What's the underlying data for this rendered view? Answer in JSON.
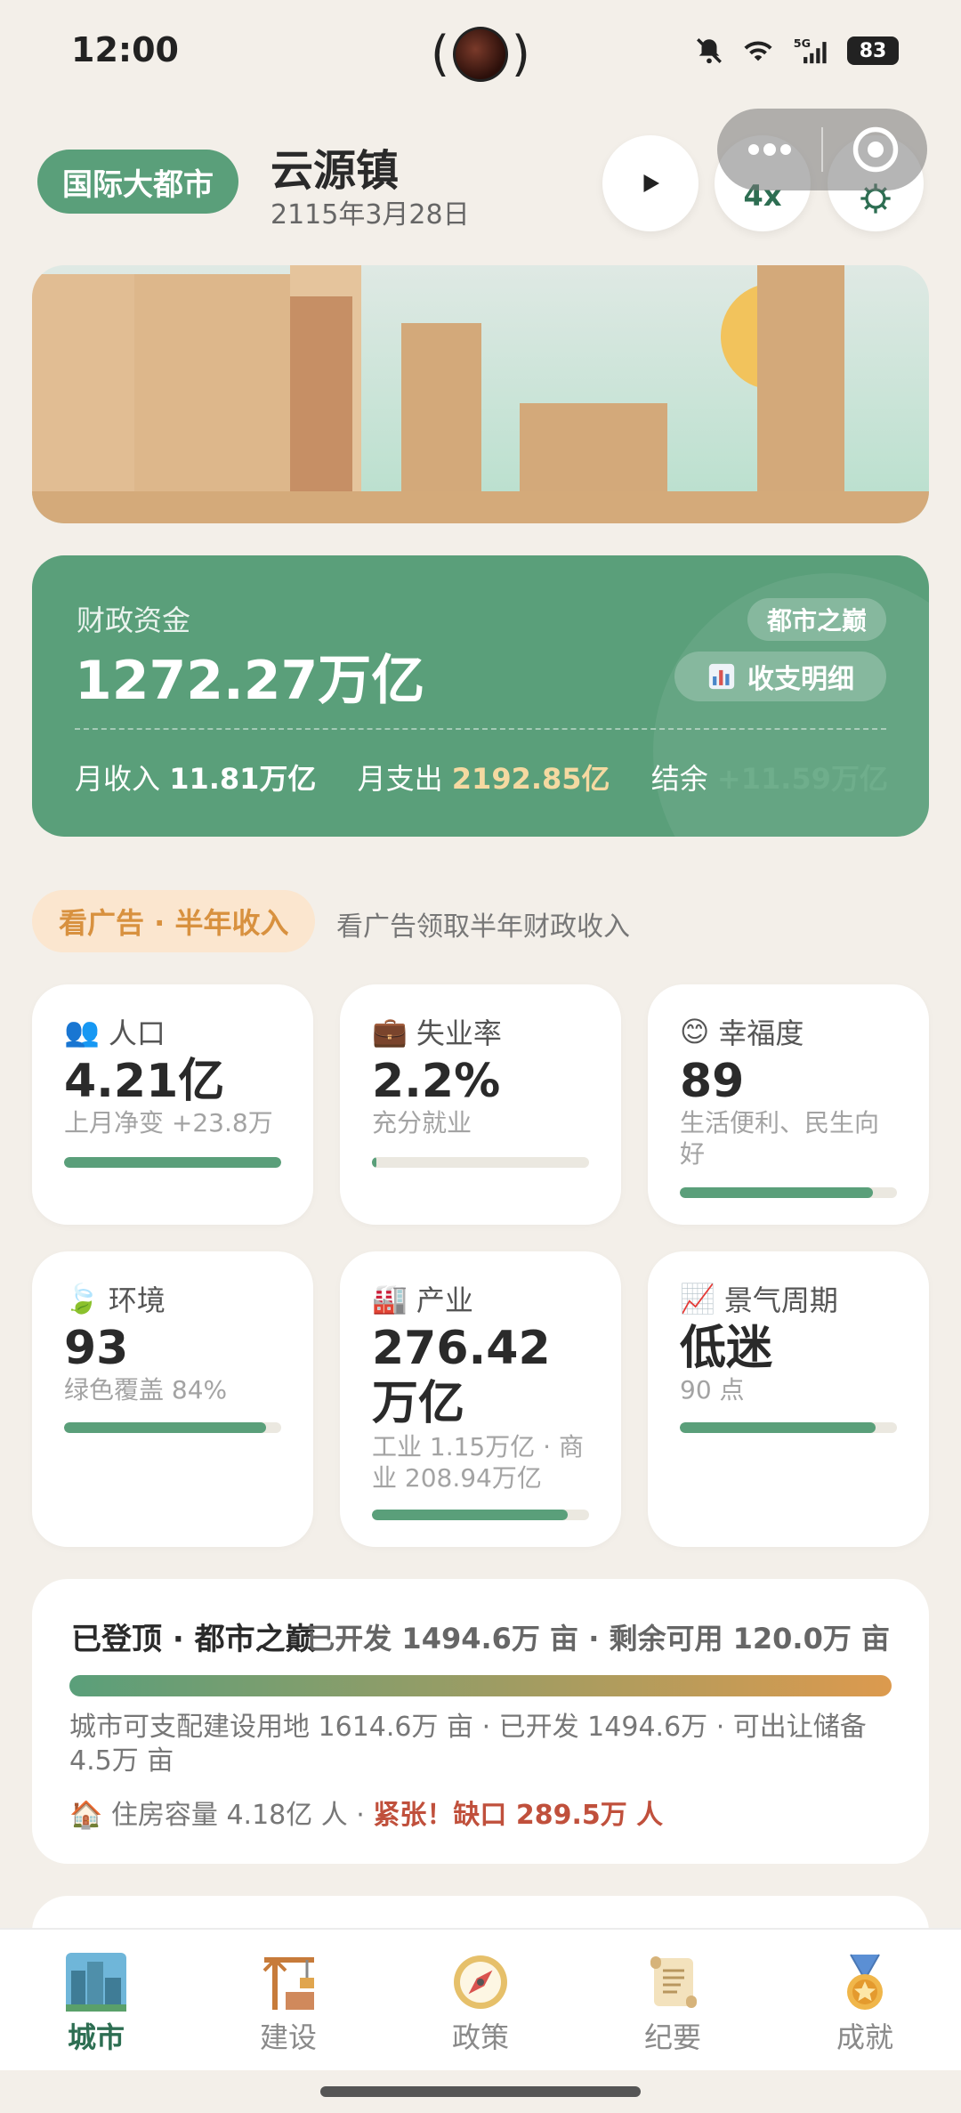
{
  "status_bar": {
    "time": "12:00",
    "battery": "83",
    "network": "5G"
  },
  "header": {
    "rank_badge": "国际大都市",
    "city_name": "云源镇",
    "date": "2115年3月28日",
    "speed": "4x"
  },
  "finance": {
    "label": "财政资金",
    "amount": "1272.27万亿",
    "tier": "都市之巅",
    "detail_button": "收支明细",
    "income_label": "月收入",
    "income_value": "11.81万亿",
    "expense_label": "月支出",
    "expense_value": "2192.85亿",
    "surplus_label": "结余",
    "surplus_value": "+11.59万亿"
  },
  "ad": {
    "button": "看广告 · 半年收入",
    "description": "看广告领取半年财政收入"
  },
  "stats": [
    {
      "icon": "👥",
      "label": "人口",
      "value": "4.21亿",
      "sub": "上月净变 +23.8万",
      "progress": 1.0
    },
    {
      "icon": "💼",
      "label": "失业率",
      "value": "2.2%",
      "sub": "充分就业",
      "progress": 0.022
    },
    {
      "icon": "😊",
      "label": "幸福度",
      "value": "89",
      "sub": "生活便利、民生向好",
      "progress": 0.89
    },
    {
      "icon": "🍃",
      "label": "环境",
      "value": "93",
      "sub": "绿色覆盖 84%",
      "progress": 0.93
    },
    {
      "icon": "🏭",
      "label": "产业",
      "value": "276.42万亿",
      "sub": "工业 1.15万亿 · 商业 208.94万亿",
      "progress": 0.9
    },
    {
      "icon": "📈",
      "label": "景气周期",
      "value": "低迷",
      "sub": "90 点",
      "progress": 0.9
    }
  ],
  "land": {
    "title": "已登顶 · 都市之巅",
    "summary": "已开发 1494.6万 亩 · 剩余可用 120.0万 亩",
    "description": "城市可支配建设用地 1614.6万 亩 · 已开发 1494.6万 · 可出让储备 4.5万 亩",
    "housing_icon": "🏠",
    "housing": "住房容量 4.18亿 人 ·",
    "housing_warning": "紧张！缺口 289.5万 人"
  },
  "nav": [
    {
      "label": "城市",
      "icon": "city-icon",
      "active": true
    },
    {
      "label": "建设",
      "icon": "construction-crane-icon",
      "active": false
    },
    {
      "label": "政策",
      "icon": "compass-icon",
      "active": false
    },
    {
      "label": "纪要",
      "icon": "scroll-icon",
      "active": false
    },
    {
      "label": "成就",
      "icon": "medal-icon",
      "active": false
    }
  ],
  "colors": {
    "accent": "#5a9f7a",
    "background": "#f3efe9",
    "warning": "#c0503c",
    "ad_text": "#d8913f"
  }
}
